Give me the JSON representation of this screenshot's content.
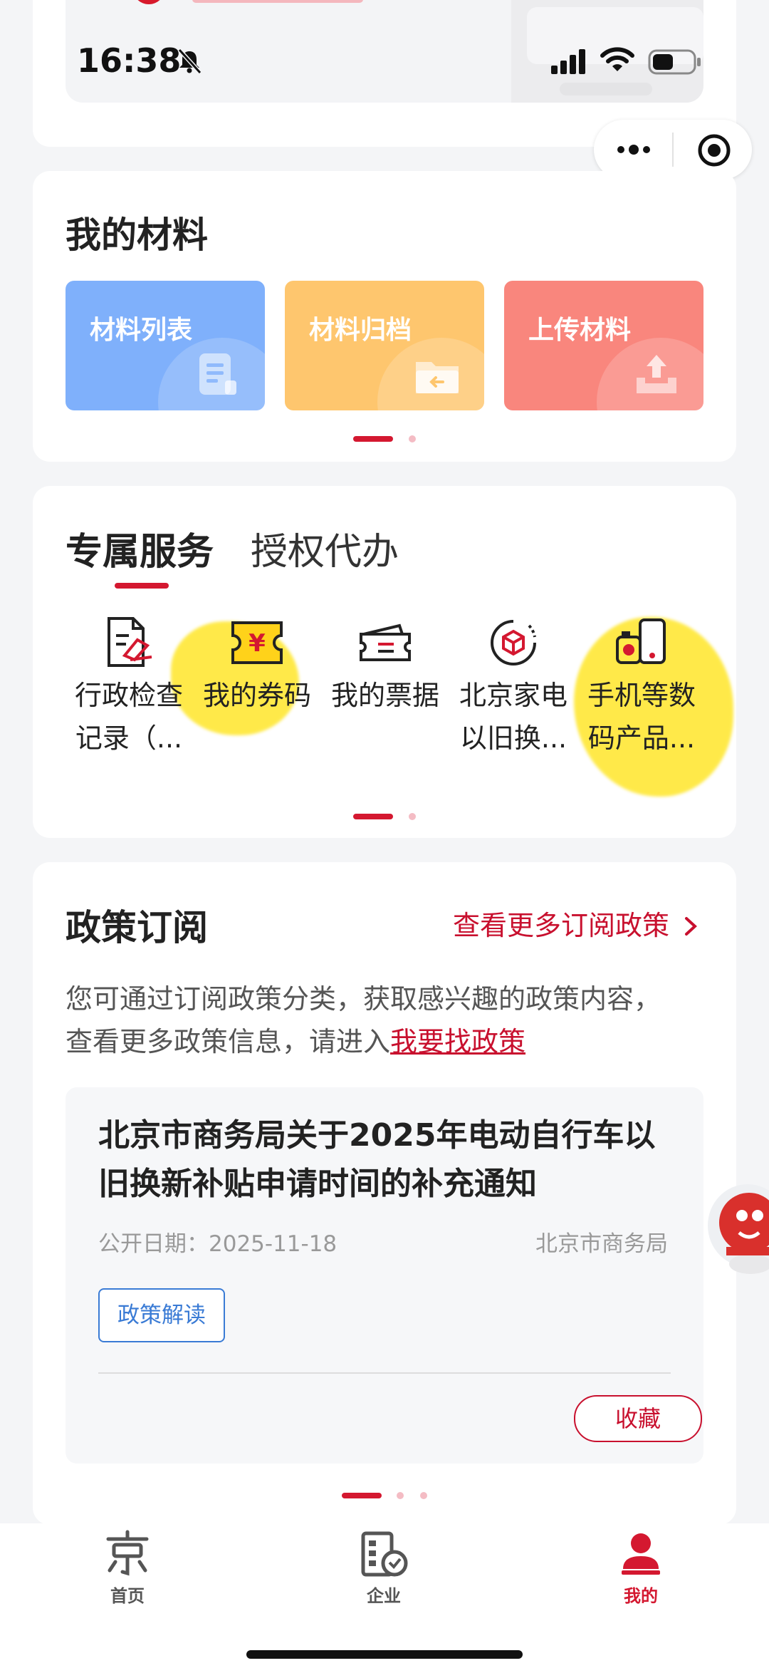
{
  "status_bar": {
    "time": "16:38"
  },
  "materials": {
    "title": "我的材料",
    "tiles": [
      {
        "label": "材料列表",
        "color": "#7fb0fb"
      },
      {
        "label": "材料归档",
        "color": "#fec66e"
      },
      {
        "label": "上传材料",
        "color": "#f9867d"
      }
    ]
  },
  "services": {
    "tabs": [
      {
        "label": "专属服务",
        "active": true
      },
      {
        "label": "授权代办",
        "active": false
      }
    ],
    "items": [
      {
        "line1": "行政检查",
        "line2": "记录（...",
        "icon": "inspection-record-icon"
      },
      {
        "line1": "我的券码",
        "line2": "",
        "icon": "coupon-icon"
      },
      {
        "line1": "我的票据",
        "line2": "",
        "icon": "ticket-icon"
      },
      {
        "line1": "北京家电",
        "line2": "以旧换...",
        "icon": "appliance-tradein-icon"
      },
      {
        "line1": "手机等数",
        "line2": "码产品...",
        "icon": "digital-products-icon"
      }
    ]
  },
  "policy": {
    "title": "政策订阅",
    "more_label": "查看更多订阅政策",
    "desc_line1": "您可通过订阅政策分类，获取感兴趣的政策内容，",
    "desc_line2_prefix": "查看更多政策信息，请进入",
    "desc_link": "我要找政策",
    "article": {
      "title": "北京市商务局关于2025年电动自行车以旧换新补贴申请时间的补充通知",
      "date": "公开日期：2025-11-18",
      "source": "北京市商务局",
      "interp_label": "政策解读",
      "collect_label": "收藏"
    }
  },
  "tabbar": {
    "items": [
      {
        "label": "首页",
        "active": false
      },
      {
        "label": "企业",
        "active": false
      },
      {
        "label": "我的",
        "active": true
      }
    ]
  },
  "colors": {
    "accent": "#d41830",
    "background": "#f4f5f7",
    "highlight": "#ffe417"
  }
}
